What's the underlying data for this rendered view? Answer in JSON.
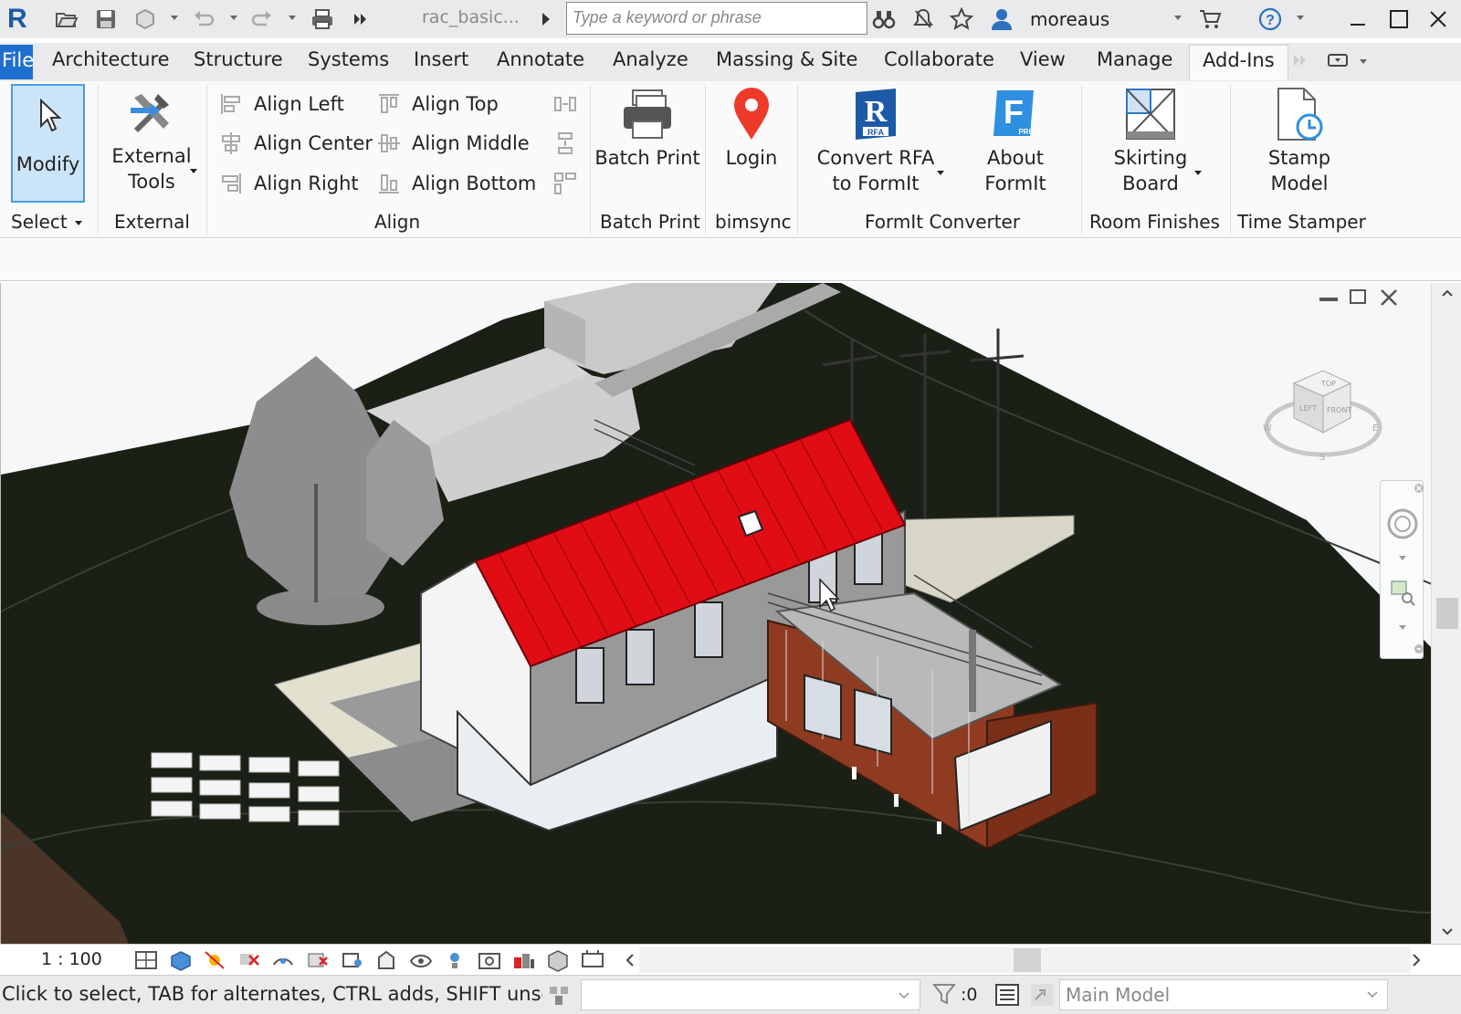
{
  "app": {
    "logo_letter": "R",
    "doc_title": "rac_basic...",
    "user": "moreaus"
  },
  "search": {
    "placeholder": "Type a keyword or phrase"
  },
  "tabs": [
    "File",
    "Architecture",
    "Structure",
    "Systems",
    "Insert",
    "Annotate",
    "Analyze",
    "Massing & Site",
    "Collaborate",
    "View",
    "Manage",
    "Add-Ins"
  ],
  "active_tab": "Add-Ins",
  "ribbon": {
    "modify": "Modify",
    "select_panel": "Select",
    "external_tools_line1": "External",
    "external_tools_line2": "Tools",
    "external_panel": "External",
    "align_left": "Align Left",
    "align_center": "Align Center",
    "align_right": "Align Right",
    "align_top": "Align Top",
    "align_middle": "Align Middle",
    "align_bottom": "Align Bottom",
    "align_panel": "Align",
    "batch_print": "Batch Print",
    "batch_print_panel": "Batch Print",
    "login": "Login",
    "bimsync_panel": "bimsync",
    "convert_rfa_line1": "Convert RFA",
    "convert_rfa_line2": "to FormIt",
    "about_formit": "About FormIt",
    "formit_panel": "FormIt Converter",
    "skirting_line1": "Skirting",
    "skirting_line2": "Board",
    "room_finishes_panel": "Room Finishes",
    "stamp_line1": "Stamp",
    "stamp_line2": "Model",
    "time_stamper_panel": "Time Stamper",
    "rfa_badge": "RFA",
    "pro_badge": "PRO"
  },
  "viewcube": {
    "top": "TOP",
    "left": "LEFT",
    "front": "FRONT",
    "w": "W",
    "e": "E",
    "s": "S"
  },
  "viewbar": {
    "scale": "1 : 100"
  },
  "status": {
    "text": "Click to select, TAB for alternates, CTRL adds, SHIFT unselects.",
    "count": ":0",
    "model": "Main Model"
  },
  "colors": {
    "accent": "#1f6fcf",
    "roof": "#e00d14",
    "ground": "#1b2016",
    "cladding": "#8f3b21"
  }
}
